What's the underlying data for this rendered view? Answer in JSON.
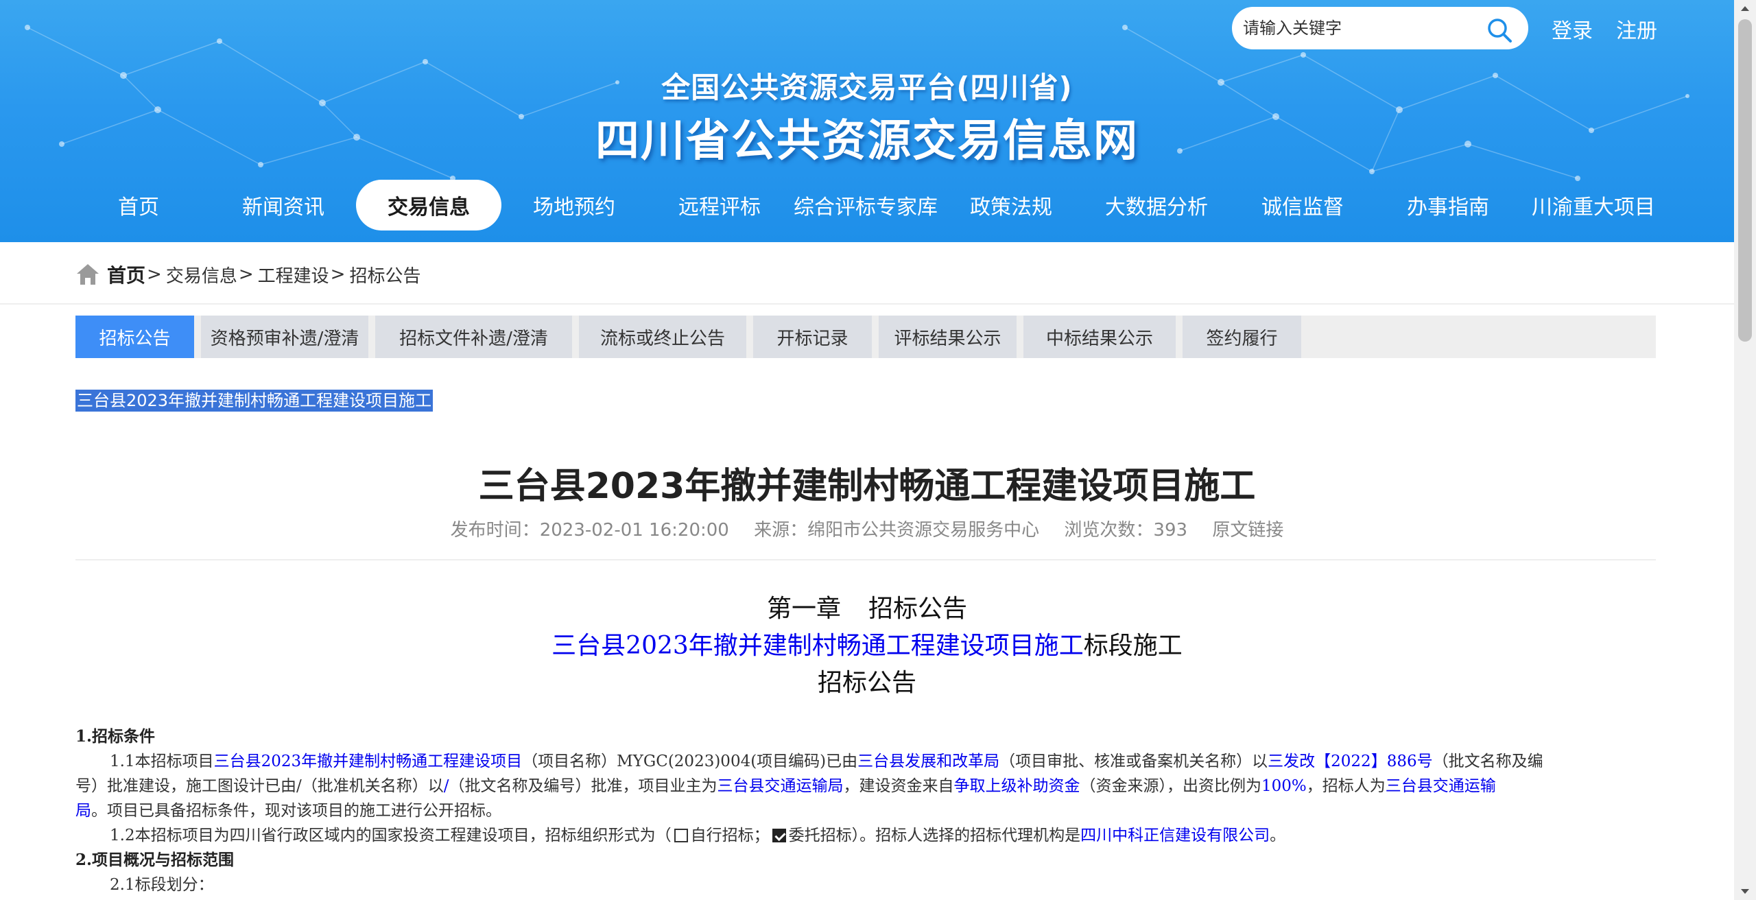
{
  "header": {
    "search_placeholder": "请输入关键字",
    "login": "登录",
    "register": "注册",
    "subtitle": "全国公共资源交易平台(四川省)",
    "title": "四川省公共资源交易信息网"
  },
  "nav": {
    "items": [
      "首页",
      "新闻资讯",
      "交易信息",
      "场地预约",
      "远程评标",
      "综合评标专家库",
      "政策法规",
      "大数据分析",
      "诚信监督",
      "办事指南",
      "川渝重大项目"
    ],
    "active": "交易信息"
  },
  "breadcrumb": {
    "home": "首页",
    "sep": ">",
    "items": [
      "交易信息",
      "工程建设",
      "招标公告"
    ]
  },
  "tabs": {
    "items": [
      "招标公告",
      "资格预审补遗/澄清",
      "招标文件补遗/澄清",
      "流标或终止公告",
      "开标记录",
      "评标结果公示",
      "中标结果公示",
      "签约履行"
    ],
    "active": "招标公告"
  },
  "article": {
    "selected_title": "三台县2023年撤并建制村畅通工程建设项目施工",
    "title": "三台县2023年撤并建制村畅通工程建设项目施工",
    "meta": {
      "publish_label": "发布时间：",
      "publish_time": "2023-02-01 16:20:00",
      "source_label": "来源：",
      "source": "绵阳市公共资源交易服务中心",
      "views_label": "浏览次数：",
      "views": "393",
      "original_link": "原文链接"
    },
    "chapter": "第一章",
    "chapter_title": "招标公告",
    "project_name": "三台县2023年撤并建制村畅通工程建设项目施工",
    "project_suffix": "标段施工",
    "notice_title": "招标公告",
    "s1_heading": "1.招标条件",
    "p11": {
      "a": "1.1本招标项目",
      "project": "三台县2023年撤并建制村畅通工程建设项目",
      "b": "（项目名称）MYGC(2023)004(项目编码)已由",
      "approver": "三台县发展和改革局",
      "c": "（项目审批、核准或备案机关名称）以",
      "approval_no": "三发改【2022】886号",
      "d": "（批文名称及编",
      "e": "号）批准建设，施工图设计已由/（批准机关名称）以",
      "slash": "/",
      "f": "（批文名称及编号）批准，项目业主为",
      "owner": "三台县交通运输局",
      "g": "，建设资金来自",
      "fund": "争取上级补助资金",
      "h": "（资金来源），出资比例为",
      "ratio": "100%",
      "i": "，招标人为",
      "tenderer_1": "三台县交通运输",
      "tenderer_2": "局",
      "j": "。项目已具备招标条件，现对该项目的施工进行公开招标。"
    },
    "p12": {
      "a": "1.2本招标项目为四川省行政区域内的国家投资工程建设项目，招标组织形式为（",
      "self": "自行招标；",
      "entrust": "委托招标",
      "b": "）。招标人选择的招标代理机构是",
      "agency": "四川中科正信建设有限公司",
      "c": "。"
    },
    "s2_heading": "2.项目概况与招标范围",
    "p21": "2.1标段划分："
  }
}
